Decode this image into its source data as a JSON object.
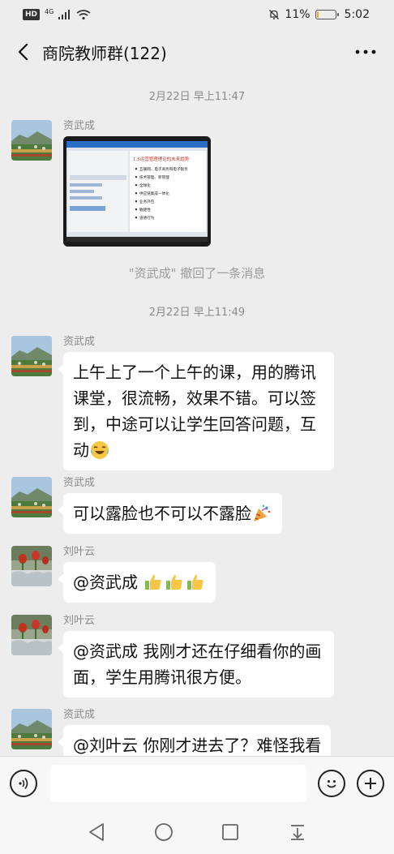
{
  "status_bar": {
    "hd_label": "HD",
    "network_label": "4G",
    "battery_text": "11%",
    "battery_level": 0.11,
    "time": "5:02"
  },
  "header": {
    "title": "商院教师群(122)"
  },
  "messages": [
    {
      "type": "timestamp",
      "text": "2月22日 早上11:47"
    },
    {
      "type": "image",
      "sender": "资武成",
      "image": {
        "slide_title": "1.5运营管理理论的未来趋势",
        "bullets": [
          "互联网、电子商务和电子银务",
          "技术管理、新管理",
          "全球化",
          "供应链集成一体化",
          "业务外包",
          "敏捷性",
          "道德行为"
        ]
      }
    },
    {
      "type": "system",
      "text": "\"资武成\" 撤回了一条消息"
    },
    {
      "type": "timestamp",
      "text": "2月22日 早上11:49"
    },
    {
      "type": "text",
      "sender": "资武成",
      "text": "上午上了一个上午的课，用的腾讯课堂，很流畅，效果不错。可以签到，中途可以让学生回答问题，互动",
      "emoji": "laugh-cry-emoji"
    },
    {
      "type": "text",
      "sender": "资武成",
      "text": "可以露脸也不可以不露脸",
      "emoji": "party-popper-emoji"
    },
    {
      "type": "text",
      "sender": "刘叶云",
      "text": "@资武成 ",
      "emoji": "thumbs-up-emoji x3"
    },
    {
      "type": "text",
      "sender": "刘叶云",
      "text": "@资武成  我刚才还在仔细看你的画面，学生用腾讯很方便。"
    },
    {
      "type": "text",
      "sender": "资武成",
      "text": "@刘叶云  你刚才进去了？难怪我看"
    }
  ],
  "input": {
    "value": ""
  },
  "icons": {
    "back": "back-arrow-icon",
    "more": "more-dots-icon",
    "voice": "voice-icon",
    "emoji": "emoji-icon",
    "add": "add-icon",
    "nav_back": "nav-back-icon",
    "nav_home": "nav-home-icon",
    "nav_recents": "nav-recents-icon",
    "nav_down": "nav-notification-icon"
  },
  "colors": {
    "background": "#ededed",
    "bubble": "#ffffff",
    "battery": "#f5a623"
  }
}
